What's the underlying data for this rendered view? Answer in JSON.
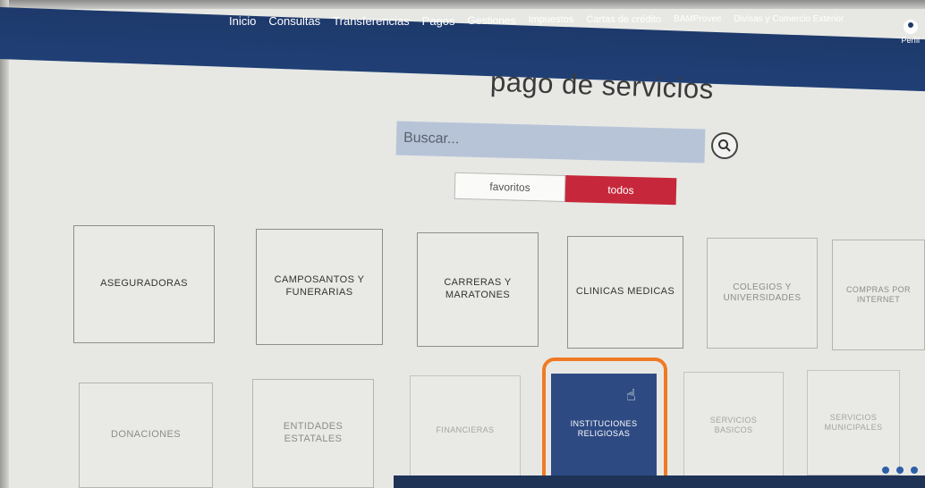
{
  "nav": {
    "items": [
      "Inicio",
      "Consultas",
      "Transferencias",
      "Pagos",
      "Gestiones",
      "Impuestos",
      "Cartas de crédito",
      "BAMProvee",
      "Divisas y Comercio Exterior"
    ],
    "profile_label": "Perfil"
  },
  "page": {
    "title": "pago de servicios"
  },
  "search": {
    "placeholder": "Buscar..."
  },
  "toggle": {
    "favorites": "favoritos",
    "all": "todos",
    "active": "todos"
  },
  "categories": {
    "row1": [
      "ASEGURADORAS",
      "CAMPOSANTOS Y FUNERARIAS",
      "CARRERAS Y MARATONES",
      "CLINICAS MEDICAS",
      "COLEGIOS Y UNIVERSIDADES",
      "COMPRAS POR INTERNET"
    ],
    "row2": [
      "DONACIONES",
      "ENTIDADES ESTATALES",
      "FINANCIERAS",
      "INSTITUCIONES RELIGIOSAS",
      "SERVICIOS BASICOS",
      "SERVICIOS MUNICIPALES"
    ],
    "selected": "INSTITUCIONES RELIGIOSAS"
  },
  "colors": {
    "nav_bg": "#1e3a6b",
    "active_tab": "#c7273b",
    "selected_tile": "#2e4a82",
    "highlight": "#f07a24"
  },
  "icons": {
    "search": "search-icon",
    "profile": "user-icon",
    "cursor": "hand-pointer-icon"
  }
}
